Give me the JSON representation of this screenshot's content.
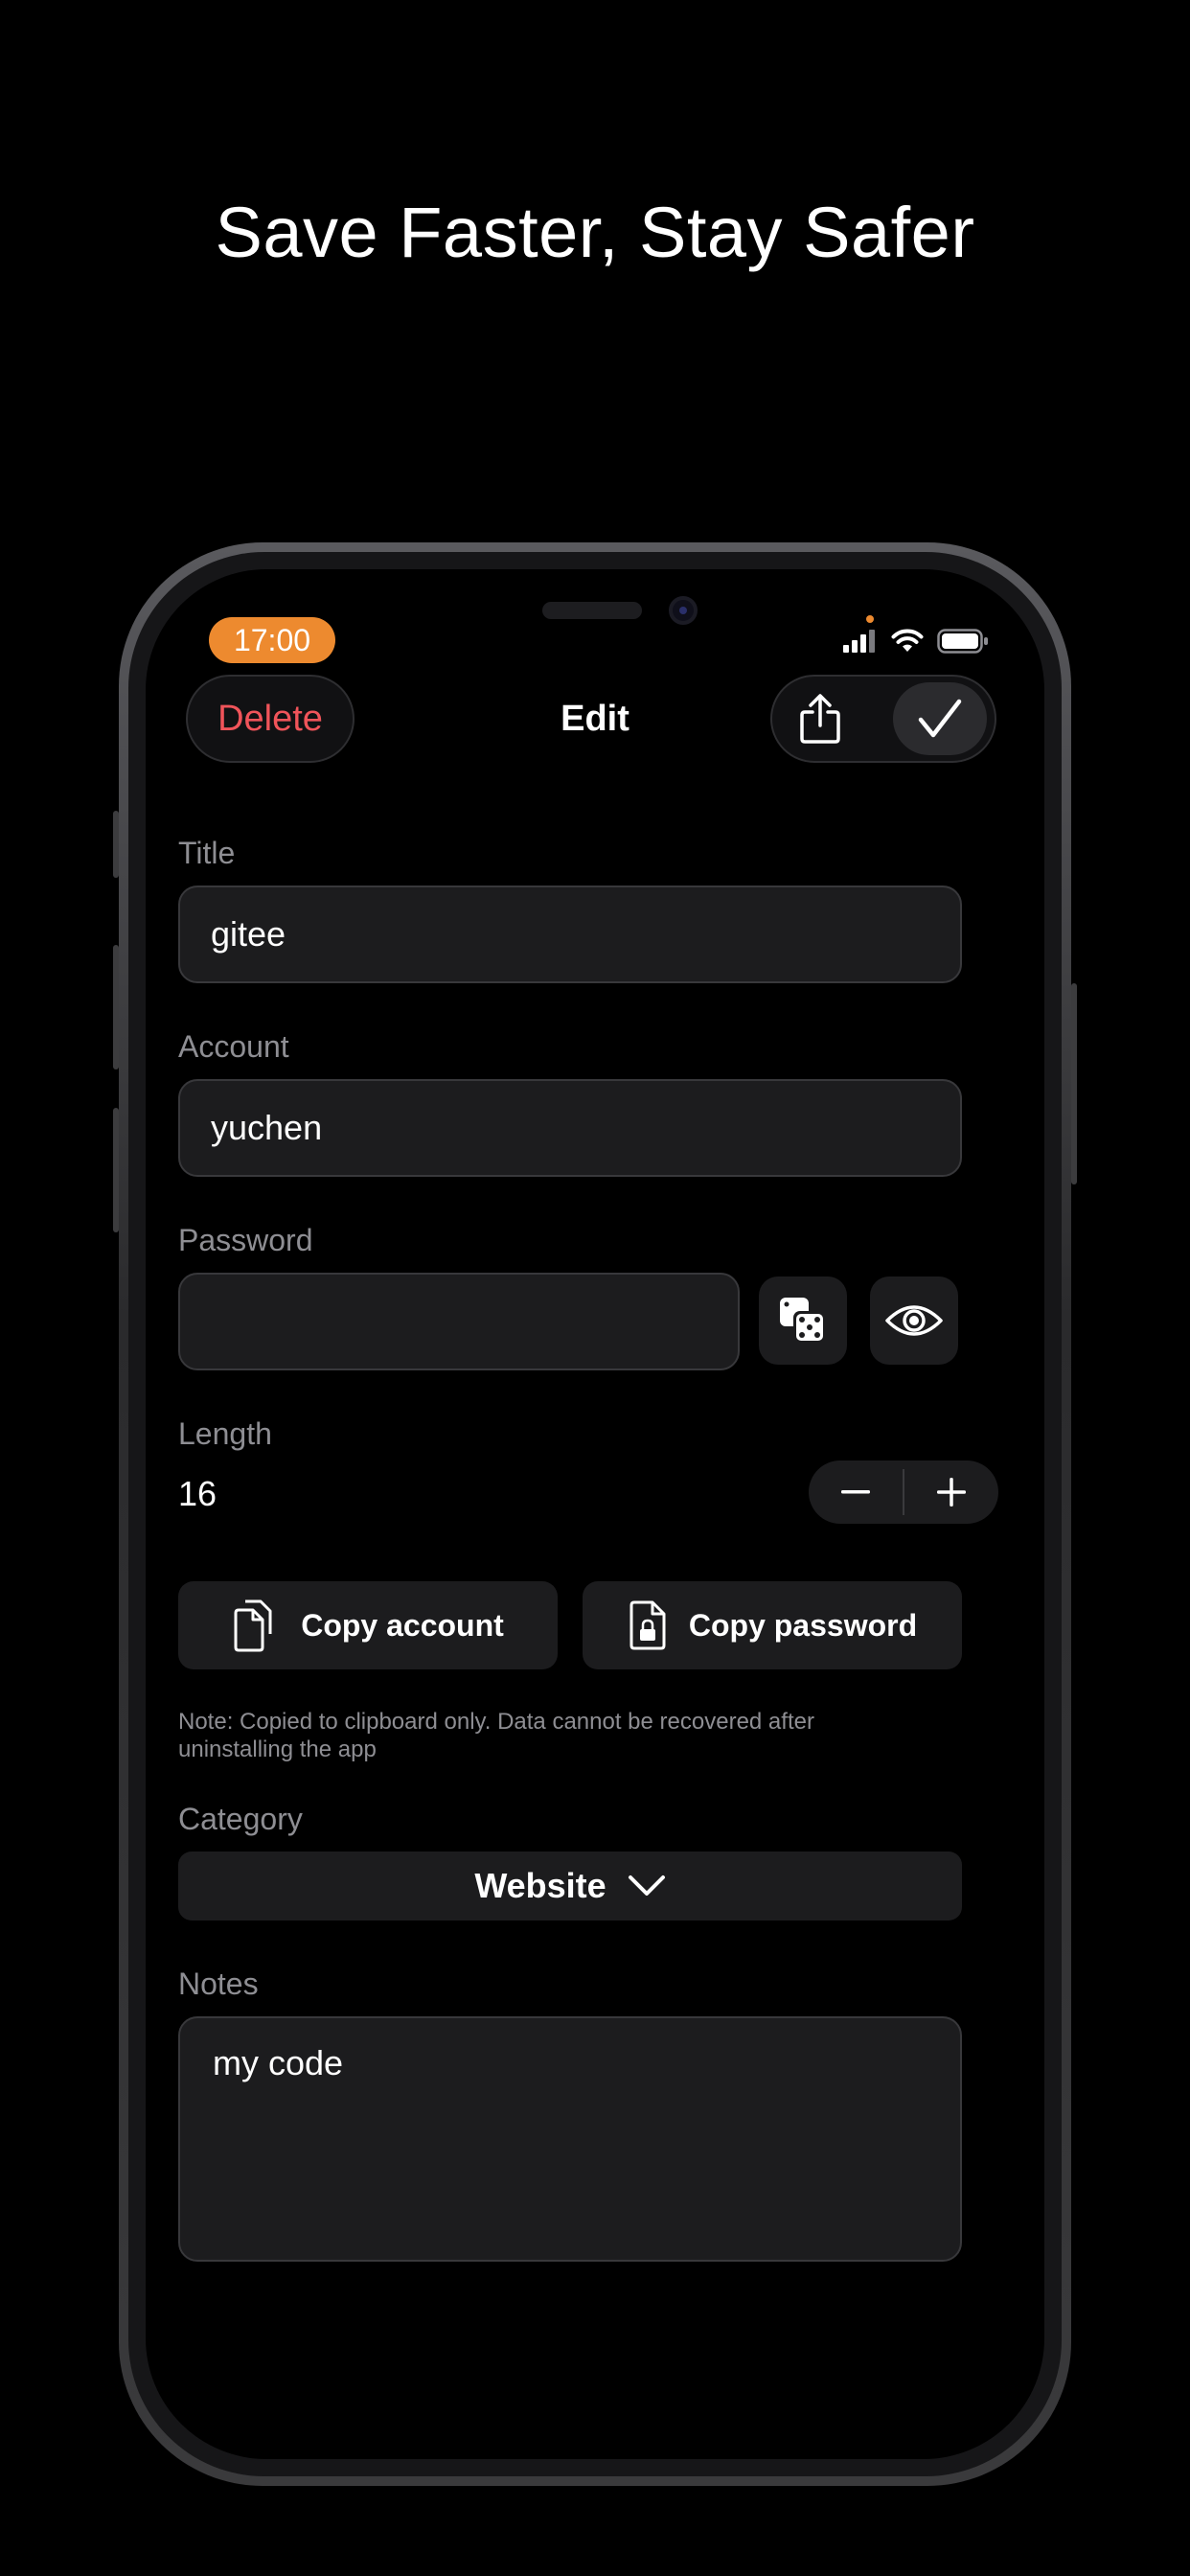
{
  "headline": "Save Faster, Stay Safer",
  "status_bar": {
    "time": "17:00"
  },
  "nav": {
    "delete_label": "Delete",
    "title": "Edit"
  },
  "form": {
    "title": {
      "label": "Title",
      "value": "gitee"
    },
    "account": {
      "label": "Account",
      "value": "yuchen"
    },
    "password": {
      "label": "Password",
      "value": ""
    },
    "length": {
      "label": "Length",
      "value": "16"
    },
    "copy_account_label": "Copy account",
    "copy_password_label": "Copy password",
    "note": "Note: Copied to clipboard only. Data cannot be recovered after uninstalling the app",
    "category": {
      "label": "Category",
      "value": "Website"
    },
    "notes": {
      "label": "Notes",
      "value": "my code"
    }
  },
  "colors": {
    "accent_orange": "#ed8a2f",
    "delete_red": "#f0545a",
    "field_bg": "#1c1c1e"
  },
  "icons": [
    "share-icon",
    "checkmark-icon",
    "dice-icon",
    "eye-icon",
    "minus-icon",
    "plus-icon",
    "copy-documents-icon",
    "locked-document-icon",
    "chevron-down-icon",
    "cellular-signal-icon",
    "wifi-icon",
    "battery-icon"
  ]
}
